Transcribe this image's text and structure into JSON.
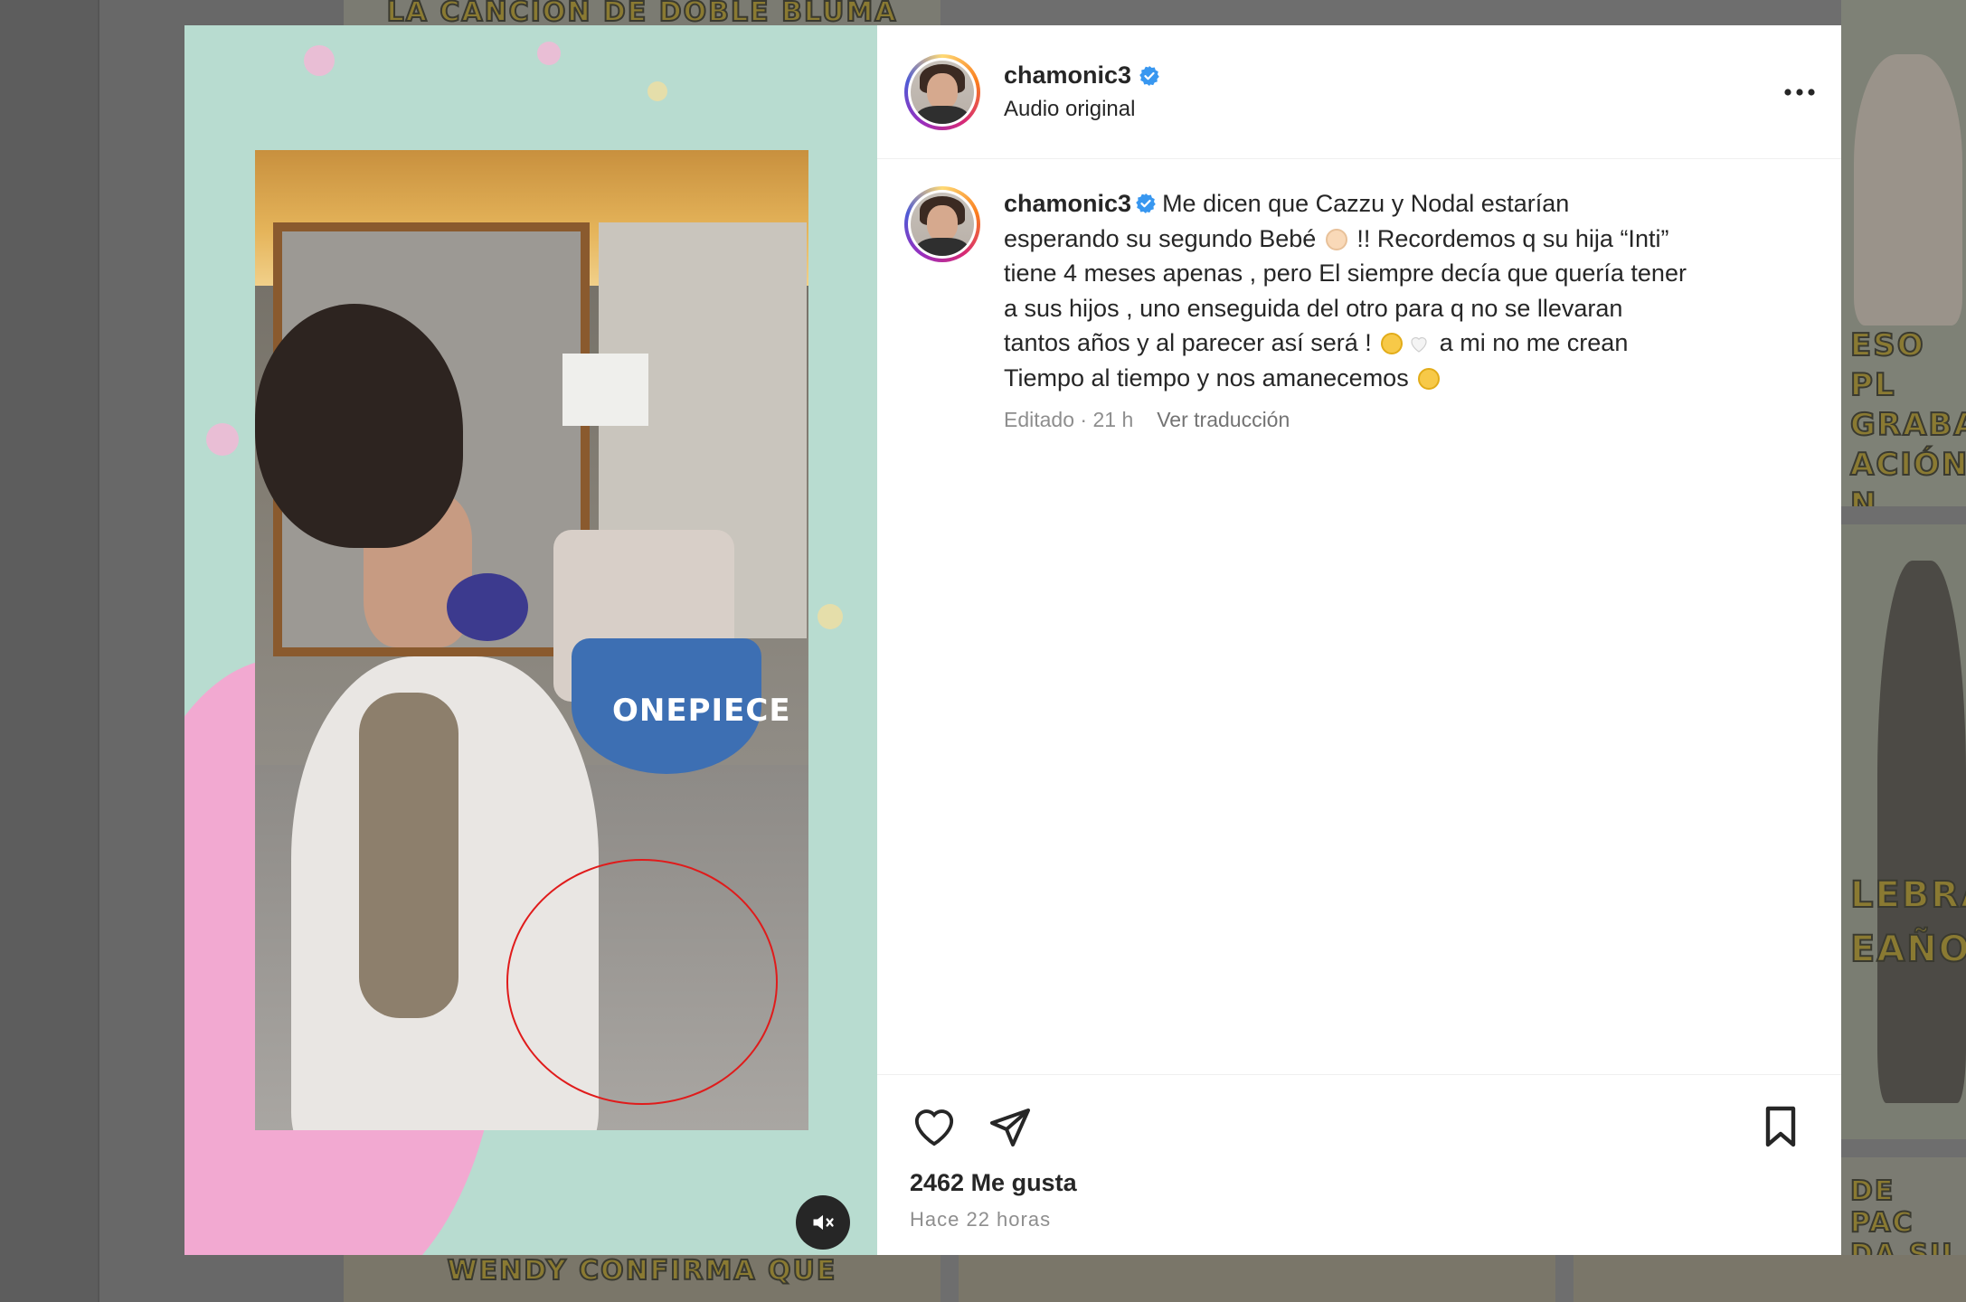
{
  "post": {
    "username": "chamonic3",
    "verified": true,
    "audio": "Audio original",
    "more_icon": "more-horizontal-icon",
    "caption_lines": [
      "Me dicen que Cazzu y Nodal estarían",
      "esperando su segundo Bebé",
      "!! Recordemos q su hija “Inti”",
      "tiene 4 meses apenas , pero El siempre decía que quería tener",
      "a sus hijos , uno enseguida del otro para q no se llevaran",
      "tantos años y al parecer así será !",
      "a mi no me crean",
      "Tiempo al tiempo y nos amanecemos"
    ],
    "edited": "Editado",
    "edited_time": "21 h",
    "separator": "·",
    "translate": "Ver traducción",
    "likes": "2462 Me gusta",
    "posted": "Hace 22 horas",
    "accent_color": "#0095f6",
    "verified_color": "#3897f0"
  },
  "media": {
    "mute_icon": "speaker-muted-icon",
    "cake_label": "ONEPIECE"
  },
  "background": {
    "tile_texts": [
      "LA CANCIÓN DE DOBLE BLUMA",
      "ESO PL GRABAR ACIÓN N",
      "LEBRA EAÑO",
      "DE PAC DA SU VERSIÓN",
      "WENDY CONFIRMA QUE"
    ]
  },
  "icons": {
    "like": "heart-icon",
    "share": "paper-plane-icon",
    "save": "bookmark-icon"
  }
}
